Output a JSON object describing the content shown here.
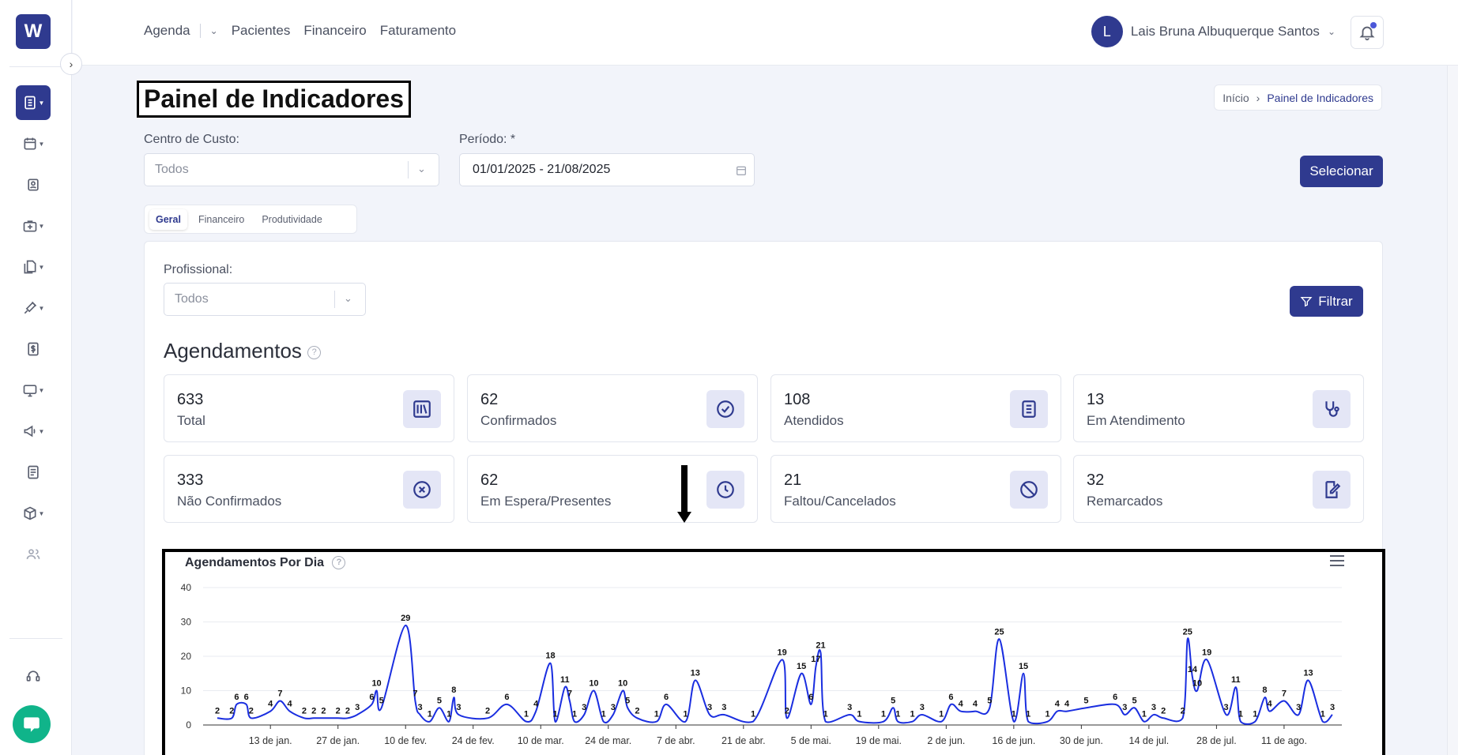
{
  "app": {
    "logo_letter": "W"
  },
  "topnav": {
    "items": [
      "Agenda",
      "Pacientes",
      "Financeiro",
      "Faturamento"
    ]
  },
  "user": {
    "initial": "L",
    "name": "Lais Bruna Albuquerque Santos"
  },
  "page": {
    "title": "Painel de Indicadores"
  },
  "breadcrumb": {
    "home": "Início",
    "current": "Painel de Indicadores"
  },
  "filters": {
    "cost_center_label": "Centro de Custo:",
    "cost_center_value": "Todos",
    "period_label": "Período: *",
    "period_value": "01/01/2025 - 21/08/2025",
    "select_button": "Selecionar"
  },
  "tabs": [
    "Geral",
    "Financeiro",
    "Produtividade"
  ],
  "professional": {
    "label": "Profissional:",
    "value": "Todos",
    "filter_button": "Filtrar"
  },
  "section": {
    "title": "Agendamentos",
    "help": "?"
  },
  "cards": [
    {
      "value": "633",
      "label": "Total",
      "icon": "books-icon"
    },
    {
      "value": "62",
      "label": "Confirmados",
      "icon": "check-circle-icon"
    },
    {
      "value": "108",
      "label": "Atendidos",
      "icon": "notebook-icon"
    },
    {
      "value": "13",
      "label": "Em Atendimento",
      "icon": "stethoscope-icon"
    },
    {
      "value": "333",
      "label": "Não Confirmados",
      "icon": "x-circle-icon"
    },
    {
      "value": "62",
      "label": "Em Espera/Presentes",
      "icon": "clock-icon"
    },
    {
      "value": "21",
      "label": "Faltou/Cancelados",
      "icon": "ban-icon"
    },
    {
      "value": "32",
      "label": "Remarcados",
      "icon": "edit-note-icon"
    }
  ],
  "colors": {
    "primary": "#2f3a8f",
    "line": "#1a2ee0",
    "chat": "#10b48a"
  },
  "chart_data": {
    "type": "line",
    "title": "Agendamentos Por Dia",
    "ylim": [
      0,
      40
    ],
    "y_ticks": [
      "0",
      "10",
      "20",
      "30",
      "40"
    ],
    "x_tick_labels": [
      "13 de jan.",
      "27 de jan.",
      "10 de fev.",
      "24 de fev.",
      "10 de mar.",
      "24 de mar.",
      "7 de abr.",
      "21 de abr.",
      "5 de mai.",
      "19 de mai.",
      "2 de jun.",
      "16 de jun.",
      "30 de jun.",
      "14 de jul.",
      "28 de jul.",
      "11 de ago."
    ],
    "grid": true,
    "series": [
      {
        "points": [
          [
            "2025-01-02",
            2
          ],
          [
            "2025-01-05",
            2
          ],
          [
            "2025-01-06",
            6
          ],
          [
            "2025-01-08",
            6
          ],
          [
            "2025-01-09",
            2
          ],
          [
            "2025-01-13",
            4
          ],
          [
            "2025-01-15",
            7
          ],
          [
            "2025-01-17",
            4
          ],
          [
            "2025-01-20",
            2
          ],
          [
            "2025-01-22",
            2
          ],
          [
            "2025-01-24",
            2
          ],
          [
            "2025-01-27",
            2
          ],
          [
            "2025-01-29",
            2
          ],
          [
            "2025-01-31",
            3
          ],
          [
            "2025-02-03",
            6
          ],
          [
            "2025-02-04",
            10
          ],
          [
            "2025-02-05",
            5
          ],
          [
            "2025-02-10",
            29
          ],
          [
            "2025-02-12",
            7
          ],
          [
            "2025-02-13",
            3
          ],
          [
            "2025-02-15",
            1
          ],
          [
            "2025-02-17",
            5
          ],
          [
            "2025-02-19",
            1
          ],
          [
            "2025-02-20",
            8
          ],
          [
            "2025-02-21",
            3
          ],
          [
            "2025-02-27",
            2
          ],
          [
            "2025-03-03",
            6
          ],
          [
            "2025-03-07",
            1
          ],
          [
            "2025-03-09",
            4
          ],
          [
            "2025-03-12",
            18
          ],
          [
            "2025-03-13",
            1
          ],
          [
            "2025-03-15",
            11
          ],
          [
            "2025-03-16",
            7
          ],
          [
            "2025-03-17",
            1
          ],
          [
            "2025-03-19",
            3
          ],
          [
            "2025-03-21",
            10
          ],
          [
            "2025-03-23",
            1
          ],
          [
            "2025-03-25",
            3
          ],
          [
            "2025-03-27",
            10
          ],
          [
            "2025-03-28",
            5
          ],
          [
            "2025-03-30",
            2
          ],
          [
            "2025-04-03",
            1
          ],
          [
            "2025-04-05",
            6
          ],
          [
            "2025-04-09",
            1
          ],
          [
            "2025-04-11",
            13
          ],
          [
            "2025-04-14",
            3
          ],
          [
            "2025-04-17",
            3
          ],
          [
            "2025-04-23",
            1
          ],
          [
            "2025-04-29",
            19
          ],
          [
            "2025-04-30",
            2
          ],
          [
            "2025-05-03",
            15
          ],
          [
            "2025-05-05",
            6
          ],
          [
            "2025-05-06",
            17
          ],
          [
            "2025-05-07",
            21
          ],
          [
            "2025-05-08",
            1
          ],
          [
            "2025-05-13",
            3
          ],
          [
            "2025-05-15",
            1
          ],
          [
            "2025-05-20",
            1
          ],
          [
            "2025-05-22",
            5
          ],
          [
            "2025-05-23",
            1
          ],
          [
            "2025-05-26",
            1
          ],
          [
            "2025-05-28",
            3
          ],
          [
            "2025-06-01",
            1
          ],
          [
            "2025-06-03",
            6
          ],
          [
            "2025-06-05",
            4
          ],
          [
            "2025-06-08",
            4
          ],
          [
            "2025-06-11",
            5
          ],
          [
            "2025-06-13",
            25
          ],
          [
            "2025-06-16",
            1
          ],
          [
            "2025-06-18",
            15
          ],
          [
            "2025-06-19",
            1
          ],
          [
            "2025-06-23",
            1
          ],
          [
            "2025-06-25",
            4
          ],
          [
            "2025-06-27",
            4
          ],
          [
            "2025-07-01",
            5
          ],
          [
            "2025-07-07",
            6
          ],
          [
            "2025-07-09",
            3
          ],
          [
            "2025-07-11",
            5
          ],
          [
            "2025-07-13",
            1
          ],
          [
            "2025-07-15",
            3
          ],
          [
            "2025-07-17",
            2
          ],
          [
            "2025-07-21",
            2
          ],
          [
            "2025-07-22",
            25
          ],
          [
            "2025-07-23",
            14
          ],
          [
            "2025-07-24",
            10
          ],
          [
            "2025-07-26",
            19
          ],
          [
            "2025-07-30",
            3
          ],
          [
            "2025-08-01",
            11
          ],
          [
            "2025-08-02",
            1
          ],
          [
            "2025-08-05",
            1
          ],
          [
            "2025-08-07",
            8
          ],
          [
            "2025-08-08",
            4
          ],
          [
            "2025-08-11",
            7
          ],
          [
            "2025-08-14",
            3
          ],
          [
            "2025-08-16",
            13
          ],
          [
            "2025-08-19",
            1
          ],
          [
            "2025-08-21",
            3
          ]
        ]
      }
    ]
  }
}
